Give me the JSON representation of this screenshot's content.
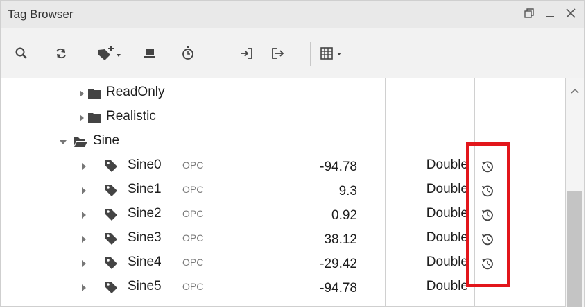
{
  "window": {
    "title": "Tag Browser",
    "controls": [
      {
        "name": "restore-icon"
      },
      {
        "name": "minimize-icon"
      },
      {
        "name": "close-icon"
      }
    ]
  },
  "toolbar": {
    "buttons": [
      {
        "name": "search-icon"
      },
      {
        "name": "refresh-icon"
      },
      {
        "name": "add-tag-icon"
      },
      {
        "name": "tag-provider-icon"
      },
      {
        "name": "history-clock-icon"
      },
      {
        "name": "import-icon"
      },
      {
        "name": "export-icon"
      },
      {
        "name": "column-view-icon"
      }
    ]
  },
  "tree": {
    "folders": [
      {
        "label": "ReadOnly",
        "expanded": false
      },
      {
        "label": "Realistic",
        "expanded": false
      },
      {
        "label": "Sine",
        "expanded": true
      }
    ],
    "tags": [
      {
        "label": "Sine0",
        "source": "OPC",
        "value": "-94.78",
        "data_type": "Double",
        "history": true
      },
      {
        "label": "Sine1",
        "source": "OPC",
        "value": "9.3",
        "data_type": "Double",
        "history": true
      },
      {
        "label": "Sine2",
        "source": "OPC",
        "value": "0.92",
        "data_type": "Double",
        "history": true
      },
      {
        "label": "Sine3",
        "source": "OPC",
        "value": "38.12",
        "data_type": "Double",
        "history": true
      },
      {
        "label": "Sine4",
        "source": "OPC",
        "value": "-29.42",
        "data_type": "Double",
        "history": true
      },
      {
        "label": "Sine5",
        "source": "OPC",
        "value": "-94.78",
        "data_type": "Double",
        "history": false
      }
    ]
  },
  "colors": {
    "highlight": "#e2161b",
    "icon": "#555555",
    "scroll_thumb": "#c4c4c4"
  }
}
